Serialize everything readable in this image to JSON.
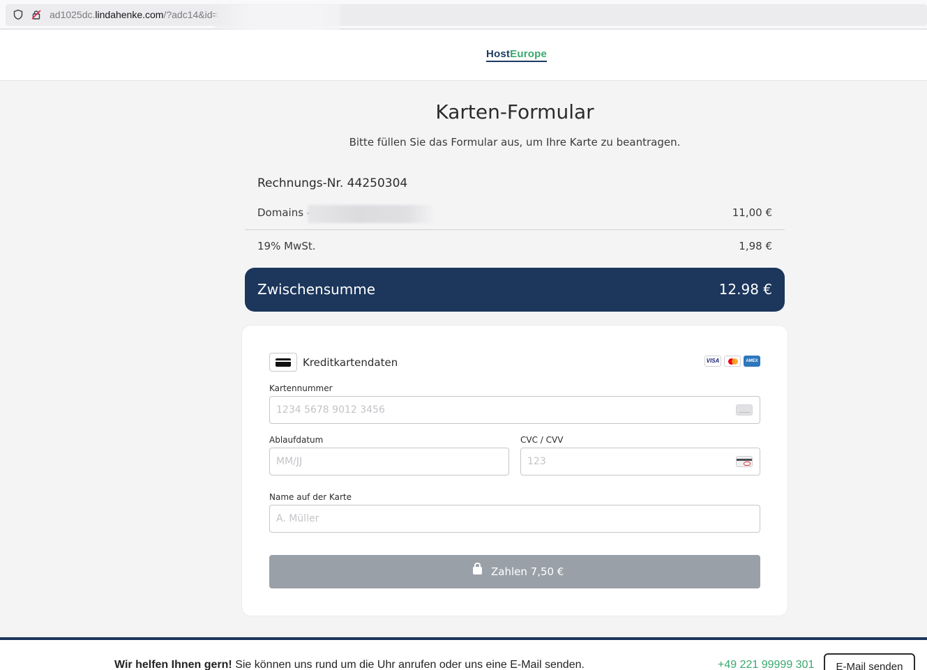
{
  "browser": {
    "url_prefix": "ad1025dc.",
    "url_host": "lindahenke.com",
    "url_path": "/?adc14&id="
  },
  "header": {
    "logo_part1": "Host",
    "logo_part2": "Europe"
  },
  "main": {
    "title": "Karten-Formular",
    "subtitle": "Bitte füllen Sie das Formular aus, um Ihre Karte zu beantragen."
  },
  "invoice": {
    "number_label": "Rechnungs-Nr. 44250304",
    "lines": [
      {
        "label": "Domains -",
        "amount": "11,00 €"
      },
      {
        "label": "19% MwSt.",
        "amount": "1,98 €"
      }
    ],
    "subtotal_label": "Zwischensumme",
    "subtotal_amount": "12.98 €"
  },
  "card_form": {
    "title": "Kreditkartendaten",
    "brands": [
      "VISA",
      "Mastercard",
      "AMEX"
    ],
    "brand_visa_text": "VISA",
    "brand_amex_text": "AMEX",
    "card_number": {
      "label": "Kartennummer",
      "placeholder": "1234 5678 9012 3456",
      "value": ""
    },
    "expiry": {
      "label": "Ablaufdatum",
      "placeholder": "MM/JJ",
      "value": ""
    },
    "cvc": {
      "label": "CVC / CVV",
      "placeholder": "123",
      "value": ""
    },
    "name": {
      "label": "Name auf der Karte",
      "placeholder": "A. Müller",
      "value": ""
    },
    "pay_button": "Zahlen 7,50 €"
  },
  "footer": {
    "help_bold": "Wir helfen Ihnen gern!",
    "help_text": " Sie können uns rund um die Uhr anrufen oder uns eine E-Mail senden.",
    "phone": "+49 221 99999 301",
    "email_button": "E-Mail senden"
  },
  "colors": {
    "primary_navy": "#1c365c",
    "accent_green": "#3aa76d",
    "pay_button_disabled": "#9aa0a8"
  }
}
